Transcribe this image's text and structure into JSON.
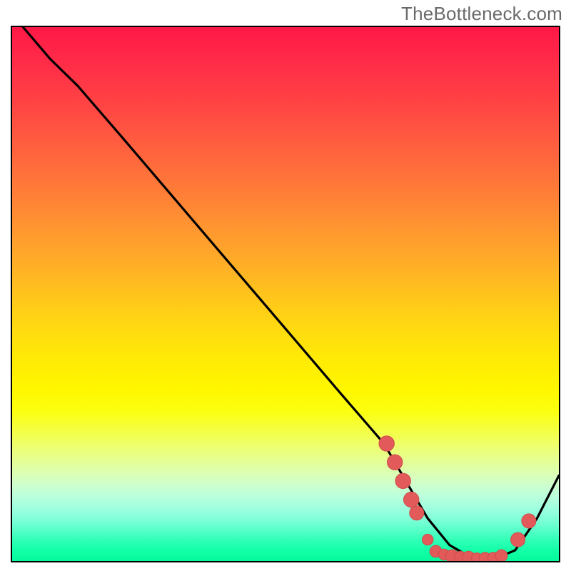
{
  "watermark": "TheBottleneck.com",
  "colors": {
    "marker": "#e35a5a",
    "marker_stroke": "#cf4b4b",
    "curve": "#000000"
  },
  "chart_data": {
    "type": "line",
    "title": "",
    "xlabel": "",
    "ylabel": "",
    "xlim": [
      0,
      100
    ],
    "ylim": [
      0,
      100
    ],
    "grid": false,
    "legend": false,
    "note": "No axis ticks or numeric labels are rendered in the image; x/y values are estimated relative positions on a 0–100 scale.",
    "series": [
      {
        "name": "curve",
        "x": [
          2,
          7,
          12,
          20,
          30,
          40,
          50,
          60,
          68,
          72,
          76,
          80,
          84,
          88,
          92,
          96,
          100
        ],
        "y": [
          100,
          94,
          89,
          79.5,
          67.5,
          55.5,
          43.5,
          31.5,
          22,
          15,
          8,
          3,
          0.6,
          0.3,
          2,
          8,
          16
        ]
      }
    ],
    "markers": [
      {
        "x": 68.5,
        "y": 22.0,
        "r": 1.4
      },
      {
        "x": 70.0,
        "y": 18.5,
        "r": 1.4
      },
      {
        "x": 71.5,
        "y": 15.0,
        "r": 1.4
      },
      {
        "x": 73.0,
        "y": 11.5,
        "r": 1.4
      },
      {
        "x": 74.0,
        "y": 9.0,
        "r": 1.3
      },
      {
        "x": 76.0,
        "y": 4.0,
        "r": 1.0
      },
      {
        "x": 77.5,
        "y": 1.8,
        "r": 1.1
      },
      {
        "x": 79.0,
        "y": 1.2,
        "r": 1.0
      },
      {
        "x": 80.5,
        "y": 0.9,
        "r": 1.2
      },
      {
        "x": 82.0,
        "y": 0.7,
        "r": 1.1
      },
      {
        "x": 83.5,
        "y": 0.6,
        "r": 1.2
      },
      {
        "x": 85.0,
        "y": 0.5,
        "r": 1.0
      },
      {
        "x": 86.5,
        "y": 0.5,
        "r": 1.1
      },
      {
        "x": 88.0,
        "y": 0.6,
        "r": 1.0
      },
      {
        "x": 89.5,
        "y": 1.0,
        "r": 1.1
      },
      {
        "x": 92.5,
        "y": 4.0,
        "r": 1.3
      },
      {
        "x": 94.5,
        "y": 7.5,
        "r": 1.3
      }
    ]
  }
}
